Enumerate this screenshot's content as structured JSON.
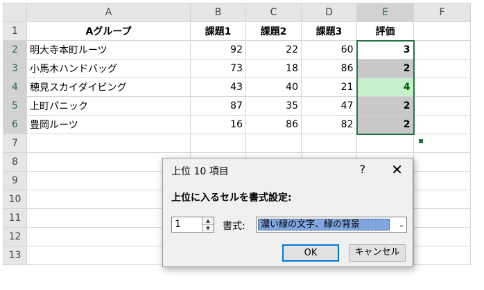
{
  "columns": [
    "A",
    "B",
    "C",
    "D",
    "E",
    "F"
  ],
  "row_numbers": [
    "1",
    "2",
    "3",
    "4",
    "5",
    "6",
    "7",
    "8",
    "9",
    "10",
    "11",
    "12",
    "13"
  ],
  "header_row": {
    "a": "Aグループ",
    "b": "課題1",
    "c": "課題2",
    "d": "課題3",
    "e": "評価"
  },
  "rows": [
    {
      "name": "明大寺本町ルーツ",
      "b": "92",
      "c": "22",
      "d": "60",
      "e": "3"
    },
    {
      "name": "小馬木ハンドバッグ",
      "b": "73",
      "c": "18",
      "d": "86",
      "e": "2"
    },
    {
      "name": "穂見スカイダイビング",
      "b": "43",
      "c": "40",
      "d": "21",
      "e": "4"
    },
    {
      "name": "上町パニック",
      "b": "87",
      "c": "35",
      "d": "47",
      "e": "2"
    },
    {
      "name": "豊岡ルーツ",
      "b": "16",
      "c": "86",
      "d": "82",
      "e": "2"
    }
  ],
  "colors": {
    "selection": "#217346",
    "highlight_fill": "#c6efce",
    "highlight_text": "#006100",
    "selection_shade": "#c8c8c8"
  },
  "dialog": {
    "title": "上位 10 項目",
    "help": "?",
    "close": "✕",
    "prompt": "上位に入るセルを書式設定:",
    "count_value": "1",
    "format_label": "書式:",
    "format_value": "濃い緑の文字、緑の背景",
    "ok": "OK",
    "cancel": "キャンセル"
  }
}
